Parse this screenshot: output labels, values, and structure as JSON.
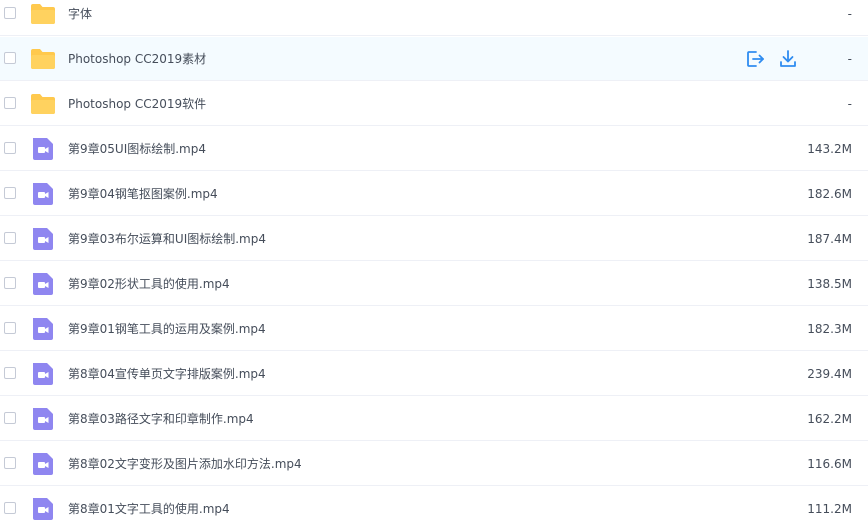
{
  "files": [
    {
      "name": "字体",
      "size": "-",
      "type": "folder"
    },
    {
      "name": "Photoshop CC2019素材",
      "size": "-",
      "type": "folder"
    },
    {
      "name": "Photoshop CC2019软件",
      "size": "-",
      "type": "folder"
    },
    {
      "name": "第9章05UI图标绘制.mp4",
      "size": "143.2M",
      "type": "video"
    },
    {
      "name": "第9章04钢笔抠图案例.mp4",
      "size": "182.6M",
      "type": "video"
    },
    {
      "name": "第9章03布尔运算和UI图标绘制.mp4",
      "size": "187.4M",
      "type": "video"
    },
    {
      "name": "第9章02形状工具的使用.mp4",
      "size": "138.5M",
      "type": "video"
    },
    {
      "name": "第9章01钢笔工具的运用及案例.mp4",
      "size": "182.3M",
      "type": "video"
    },
    {
      "name": "第8章04宣传单页文字排版案例.mp4",
      "size": "239.4M",
      "type": "video"
    },
    {
      "name": "第8章03路径文字和印章制作.mp4",
      "size": "162.2M",
      "type": "video"
    },
    {
      "name": "第8章02文字变形及图片添加水印方法.mp4",
      "size": "116.6M",
      "type": "video"
    },
    {
      "name": "第8章01文字工具的使用.mp4",
      "size": "111.2M",
      "type": "video"
    }
  ],
  "icons": {
    "folder": "folder-icon",
    "video": "video-file-icon",
    "share": "share-icon",
    "download": "download-icon"
  },
  "colors": {
    "folder": "#ffc94d",
    "video": "#8f86f0",
    "action": "#2f8cf0",
    "hover_row": "#f4fbff"
  }
}
